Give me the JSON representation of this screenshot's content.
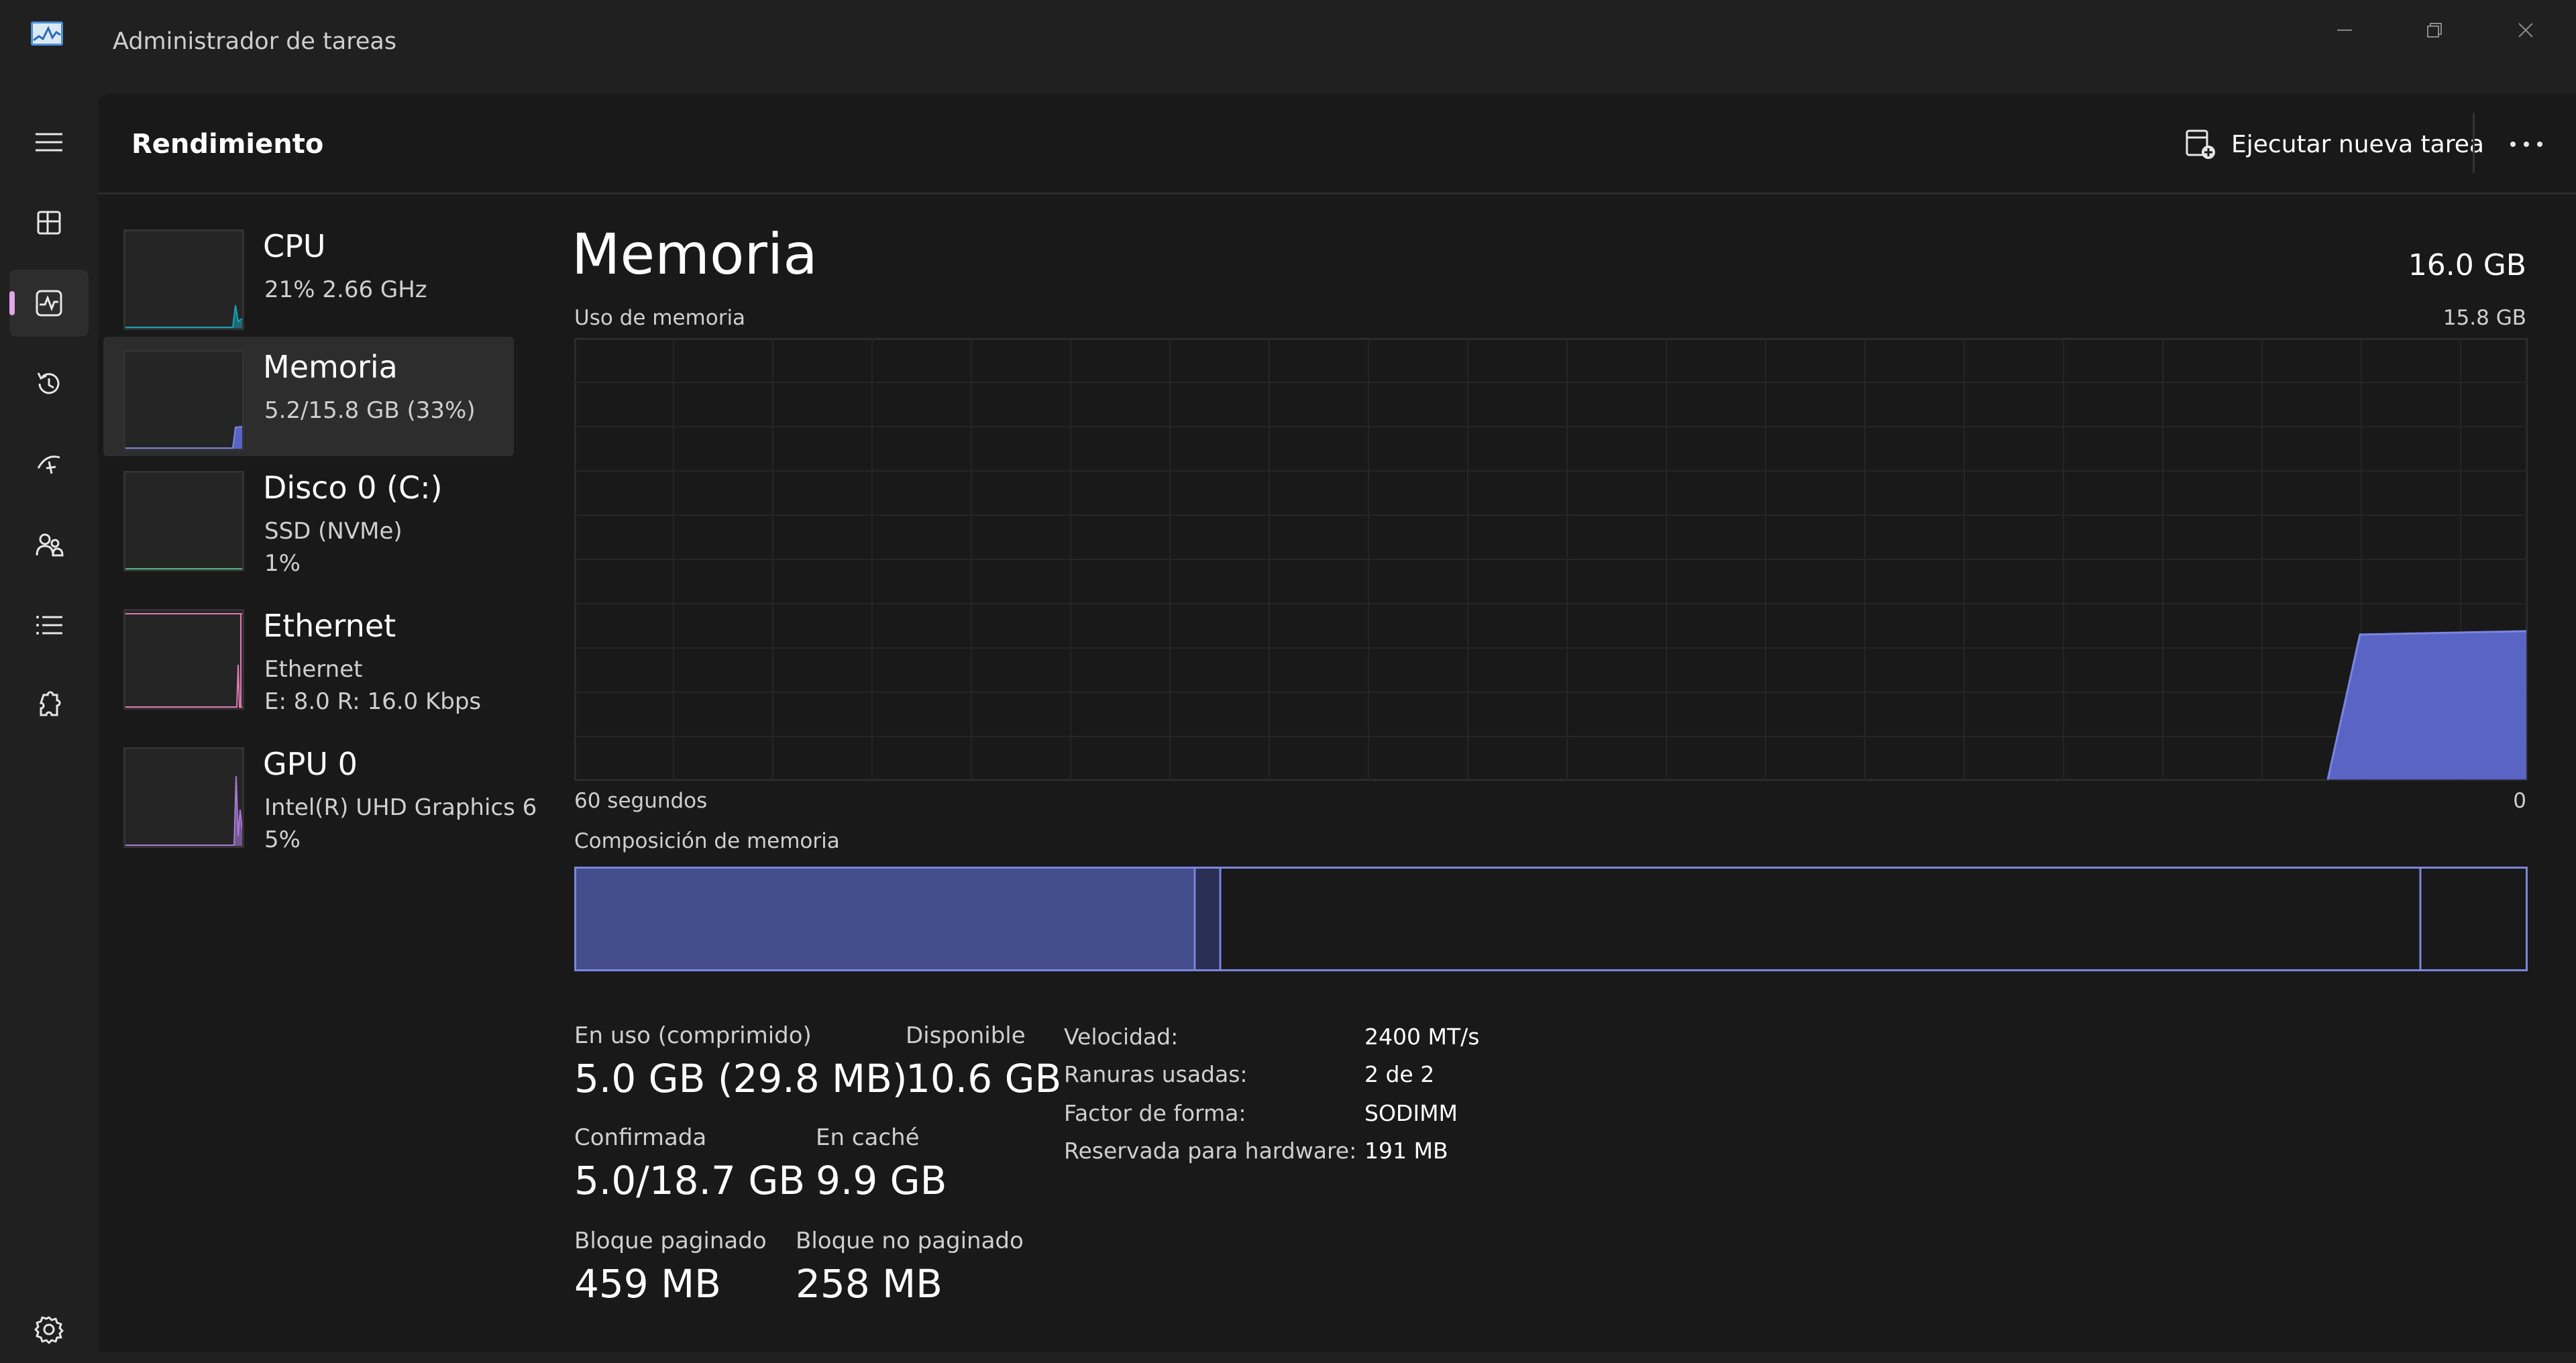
{
  "window": {
    "title": "Administrador de tareas"
  },
  "header": {
    "title": "Rendimiento",
    "run_task_label": "Ejecutar nueva tarea"
  },
  "devices": [
    {
      "name": "CPU",
      "line1": "21%  2.66 GHz",
      "line2": "",
      "color": "#17a2b8",
      "selected": false
    },
    {
      "name": "Memoria",
      "line1": "5.2/15.8 GB (33%)",
      "line2": "",
      "color": "#7a86e0",
      "selected": true
    },
    {
      "name": "Disco 0 (C:)",
      "line1": "SSD (NVMe)",
      "line2": "1%",
      "color": "#56b884",
      "selected": false
    },
    {
      "name": "Ethernet",
      "line1": "Ethernet",
      "line2": "E: 8.0  R: 16.0 Kbps",
      "color": "#e07ab0",
      "selected": false
    },
    {
      "name": "GPU 0",
      "line1": "Intel(R) UHD Graphics 6",
      "line2": "5%",
      "color": "#a77ad6",
      "selected": false
    }
  ],
  "memory": {
    "title": "Memoria",
    "total": "16.0 GB",
    "usage_label": "Uso de memoria",
    "usage_max": "15.8 GB",
    "time_label": "60 segundos",
    "time_end": "0",
    "composition_label": "Composición de memoria",
    "stats": {
      "in_use_label": "En uso (comprimido)",
      "in_use_value": "5.0 GB (29.8 MB)",
      "available_label": "Disponible",
      "available_value": "10.6 GB",
      "committed_label": "Confirmada",
      "committed_value": "5.0/18.7 GB",
      "cached_label": "En caché",
      "cached_value": "9.9 GB",
      "paged_label": "Bloque paginado",
      "paged_value": "459 MB",
      "nonpaged_label": "Bloque no paginado",
      "nonpaged_value": "258 MB"
    },
    "specs": [
      {
        "label": "Velocidad:",
        "value": "2400 MT/s"
      },
      {
        "label": "Ranuras usadas:",
        "value": "2 de 2"
      },
      {
        "label": "Factor de forma:",
        "value": "SODIMM"
      },
      {
        "label": "Reservada para hardware:",
        "value": "191 MB"
      }
    ]
  },
  "colors": {
    "accent": "#7a86e0",
    "accent_fill": "#5a64c4",
    "nav_indicator": "#e2a6e8"
  },
  "nav_icons": [
    "menu-icon",
    "processes-icon",
    "performance-icon",
    "app-history-icon",
    "startup-apps-icon",
    "users-icon",
    "details-icon",
    "services-icon",
    "settings-icon"
  ]
}
